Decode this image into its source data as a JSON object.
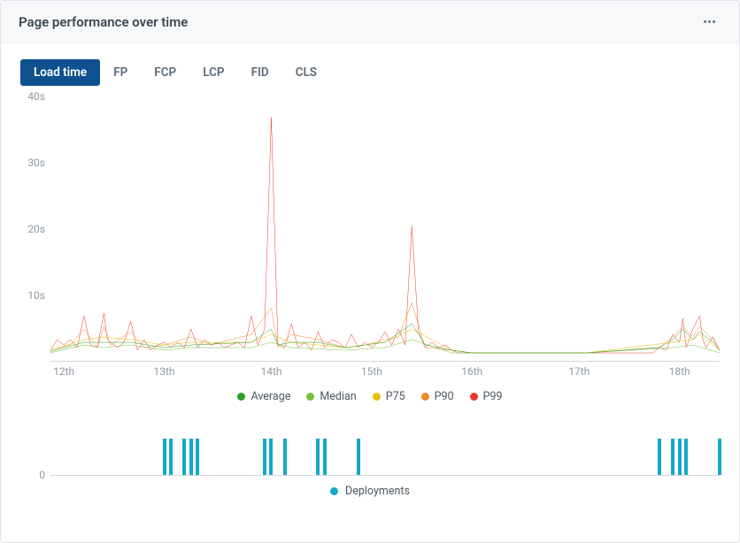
{
  "header": {
    "title": "Page performance over time"
  },
  "tabs": [
    {
      "id": "load_time",
      "label": "Load time",
      "active": true
    },
    {
      "id": "fp",
      "label": "FP",
      "active": false
    },
    {
      "id": "fcp",
      "label": "FCP",
      "active": false
    },
    {
      "id": "lcp",
      "label": "LCP",
      "active": false
    },
    {
      "id": "fid",
      "label": "FID",
      "active": false
    },
    {
      "id": "cls",
      "label": "CLS",
      "active": false
    }
  ],
  "legend": {
    "average": {
      "label": "Average",
      "color": "#2ca02c"
    },
    "median": {
      "label": "Median",
      "color": "#7abf3a"
    },
    "p75": {
      "label": "P75",
      "color": "#e6c200"
    },
    "p90": {
      "label": "P90",
      "color": "#f08a29"
    },
    "p99": {
      "label": "P99",
      "color": "#e8382a"
    }
  },
  "deploy_legend": {
    "label": "Deployments",
    "color": "#12a9c6"
  },
  "chart_data": {
    "type": "line",
    "xlabel": "",
    "ylabel": "",
    "ylim": [
      0,
      40
    ],
    "yticks": [
      0,
      10,
      20,
      30,
      40
    ],
    "ytick_labels": [
      "",
      "10s",
      "20s",
      "30s",
      "40s"
    ],
    "x_categories": [
      "12th",
      "13th",
      "14th",
      "15th",
      "16th",
      "17th",
      "18th"
    ],
    "x_tick_positions_pct": [
      2,
      17,
      33,
      48,
      63,
      79,
      94
    ],
    "series": [
      {
        "name": "P99",
        "color": "#e8382a",
        "points_pct": [
          [
            0,
            96
          ],
          [
            1,
            92
          ],
          [
            2,
            94
          ],
          [
            3,
            92
          ],
          [
            4,
            95
          ],
          [
            5,
            83
          ],
          [
            6,
            94
          ],
          [
            7,
            95
          ],
          [
            8,
            82
          ],
          [
            8.5,
            92
          ],
          [
            9,
            93
          ],
          [
            10,
            95
          ],
          [
            11,
            93
          ],
          [
            12,
            85
          ],
          [
            13,
            96
          ],
          [
            14,
            92
          ],
          [
            15,
            96
          ],
          [
            16,
            94
          ],
          [
            17,
            93
          ],
          [
            18,
            95
          ],
          [
            19,
            93
          ],
          [
            20,
            95
          ],
          [
            21,
            88
          ],
          [
            22,
            95
          ],
          [
            23,
            92
          ],
          [
            24,
            94
          ],
          [
            25,
            93
          ],
          [
            26,
            95
          ],
          [
            27,
            94
          ],
          [
            28,
            93
          ],
          [
            29,
            95
          ],
          [
            30,
            83
          ],
          [
            31,
            94
          ],
          [
            32,
            88
          ],
          [
            33,
            8
          ],
          [
            34,
            94
          ],
          [
            35,
            95
          ],
          [
            36,
            86
          ],
          [
            37,
            95
          ],
          [
            38,
            93
          ],
          [
            39,
            96
          ],
          [
            40,
            89
          ],
          [
            41,
            95
          ],
          [
            42,
            92
          ],
          [
            43,
            93
          ],
          [
            44,
            95
          ],
          [
            45,
            90
          ],
          [
            46,
            95
          ],
          [
            47,
            93
          ],
          [
            48,
            95
          ],
          [
            49,
            93
          ],
          [
            50,
            89
          ],
          [
            51,
            94
          ],
          [
            52,
            88
          ],
          [
            53,
            94
          ],
          [
            54,
            49
          ],
          [
            55,
            89
          ],
          [
            56,
            95
          ],
          [
            57,
            93
          ],
          [
            58,
            95
          ],
          [
            59,
            94
          ],
          [
            60,
            96
          ],
          [
            61,
            97
          ],
          [
            62,
            97
          ],
          [
            63,
            97
          ],
          [
            64,
            97
          ],
          [
            80,
            97
          ],
          [
            90,
            97
          ],
          [
            91,
            95
          ],
          [
            92,
            96
          ],
          [
            93,
            90
          ],
          [
            94,
            93
          ],
          [
            94.5,
            84
          ],
          [
            95,
            95
          ],
          [
            96,
            88
          ],
          [
            97,
            83
          ],
          [
            97.5,
            92
          ],
          [
            98,
            95
          ],
          [
            99,
            91
          ],
          [
            100,
            96
          ]
        ]
      },
      {
        "name": "P90",
        "color": "#f08a29",
        "points_pct": [
          [
            0,
            96
          ],
          [
            3,
            94
          ],
          [
            5,
            88
          ],
          [
            7,
            95
          ],
          [
            8,
            87
          ],
          [
            9,
            94
          ],
          [
            12,
            89
          ],
          [
            14,
            95
          ],
          [
            17,
            94
          ],
          [
            21,
            91
          ],
          [
            24,
            94
          ],
          [
            30,
            90
          ],
          [
            33,
            80
          ],
          [
            34,
            95
          ],
          [
            36,
            90
          ],
          [
            40,
            92
          ],
          [
            44,
            95
          ],
          [
            47,
            94
          ],
          [
            50,
            92
          ],
          [
            52,
            91
          ],
          [
            54,
            78
          ],
          [
            56,
            95
          ],
          [
            60,
            96
          ],
          [
            63,
            97
          ],
          [
            80,
            97
          ],
          [
            91,
            95
          ],
          [
            93,
            91
          ],
          [
            94.5,
            87
          ],
          [
            96,
            91
          ],
          [
            97,
            87
          ],
          [
            99,
            92
          ],
          [
            100,
            96
          ]
        ]
      },
      {
        "name": "P75",
        "color": "#e6c200",
        "points_pct": [
          [
            0,
            96
          ],
          [
            5,
            92
          ],
          [
            8,
            91
          ],
          [
            12,
            92
          ],
          [
            17,
            94
          ],
          [
            21,
            93
          ],
          [
            30,
            93
          ],
          [
            33,
            90
          ],
          [
            36,
            93
          ],
          [
            44,
            95
          ],
          [
            50,
            93
          ],
          [
            54,
            88
          ],
          [
            60,
            96
          ],
          [
            63,
            97
          ],
          [
            80,
            97
          ],
          [
            93,
            93
          ],
          [
            96,
            92
          ],
          [
            97,
            90
          ],
          [
            100,
            96
          ]
        ]
      },
      {
        "name": "Median",
        "color": "#7abf3a",
        "points_pct": [
          [
            0,
            97
          ],
          [
            5,
            94
          ],
          [
            8,
            95
          ],
          [
            12,
            94
          ],
          [
            17,
            96
          ],
          [
            21,
            95
          ],
          [
            30,
            95
          ],
          [
            33,
            93
          ],
          [
            36,
            95
          ],
          [
            44,
            96
          ],
          [
            50,
            95
          ],
          [
            54,
            92
          ],
          [
            60,
            97
          ],
          [
            63,
            97
          ],
          [
            80,
            97
          ],
          [
            93,
            95
          ],
          [
            96,
            94
          ],
          [
            100,
            97
          ]
        ]
      },
      {
        "name": "Average",
        "color": "#2ca02c",
        "points_pct": [
          [
            0,
            96.5
          ],
          [
            5,
            93
          ],
          [
            8,
            93
          ],
          [
            12,
            93
          ],
          [
            17,
            95
          ],
          [
            21,
            94
          ],
          [
            30,
            93
          ],
          [
            33,
            88
          ],
          [
            34,
            94
          ],
          [
            36,
            93
          ],
          [
            40,
            93
          ],
          [
            44,
            95
          ],
          [
            50,
            93
          ],
          [
            54,
            86
          ],
          [
            56,
            94
          ],
          [
            60,
            96
          ],
          [
            63,
            97
          ],
          [
            80,
            97
          ],
          [
            91,
            95
          ],
          [
            93,
            92
          ],
          [
            94.5,
            88
          ],
          [
            96,
            92
          ],
          [
            97,
            89
          ],
          [
            99,
            93
          ],
          [
            100,
            96
          ]
        ]
      }
    ],
    "deployments": {
      "type": "bar",
      "ylim": [
        0,
        1
      ],
      "ytick_label": "0",
      "color": "#12a9c6",
      "positions_pct": [
        17,
        18,
        20,
        21,
        22,
        32,
        33,
        35,
        40,
        41,
        46,
        91,
        93,
        94,
        95,
        100
      ]
    }
  }
}
